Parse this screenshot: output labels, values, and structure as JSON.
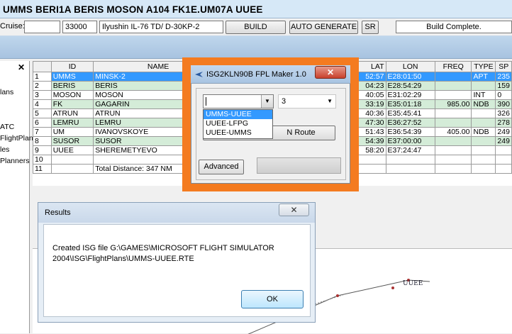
{
  "route_bar": {
    "text": "UMMS BERI1A BERIS MOSON A104 FK1E.UM07A UUEE"
  },
  "toolbar": {
    "cruise_label": "Cruise:",
    "cruise_value": "",
    "altitude": "33000",
    "aircraft": "Ilyushin IL-76 TD/ D-30KP-2",
    "build_label": "BUILD",
    "auto_generate_label": "AUTO GENERATE",
    "sr_label": "SR",
    "status": "Build Complete."
  },
  "left_pane": {
    "close": "✕",
    "items": [
      "lans",
      "ATC",
      "FlightPlans",
      "les",
      "Planners"
    ]
  },
  "grid": {
    "columns": [
      "",
      "ID",
      "NAME",
      "LAT",
      "LON",
      "FREQ",
      "TYPE",
      "SP"
    ],
    "rows": [
      {
        "n": "1",
        "id": "UMMS",
        "name": "MINSK-2",
        "lat": "52:57",
        "lon": "E28:01:50",
        "freq": "",
        "type": "APT",
        "sp": "235"
      },
      {
        "n": "2",
        "id": "BERIS",
        "name": "BERIS",
        "lat": "04:23",
        "lon": "E28:54:29",
        "freq": "",
        "type": "",
        "sp": "159"
      },
      {
        "n": "3",
        "id": "MOSON",
        "name": "MOSON",
        "lat": "40:05",
        "lon": "E31:02:29",
        "freq": "",
        "type": "INT",
        "sp": "0"
      },
      {
        "n": "4",
        "id": "FK",
        "name": "GAGARIN",
        "lat": "33:19",
        "lon": "E35:01:18",
        "freq": "985.00",
        "type": "NDB",
        "sp": "390"
      },
      {
        "n": "5",
        "id": "ATRUN",
        "name": "ATRUN",
        "lat": "40:36",
        "lon": "E35:45:41",
        "freq": "",
        "type": "",
        "sp": "326"
      },
      {
        "n": "6",
        "id": "LEMRU",
        "name": "LEMRU",
        "lat": "47:30",
        "lon": "E36:27:52",
        "freq": "",
        "type": "",
        "sp": "278"
      },
      {
        "n": "7",
        "id": "UM",
        "name": "IVANOVSKOYE",
        "lat": "51:43",
        "lon": "E36:54:39",
        "freq": "405.00",
        "type": "NDB",
        "sp": "249"
      },
      {
        "n": "8",
        "id": "SUSOR",
        "name": "SUSOR",
        "lat": "54:39",
        "lon": "E37:00:00",
        "freq": "",
        "type": "",
        "sp": "249"
      },
      {
        "n": "9",
        "id": "UUEE",
        "name": "SHEREMETYEVO",
        "lat": "58:20",
        "lon": "E37:24:47",
        "freq": "",
        "type": "",
        "sp": ""
      },
      {
        "n": "10",
        "id": "",
        "name": "",
        "lat": "",
        "lon": "",
        "freq": "",
        "type": "",
        "sp": ""
      },
      {
        "n": "11",
        "id": "",
        "name": "Total Distance: 347 NM",
        "lat": "",
        "lon": "",
        "freq": "",
        "type": "",
        "sp": ""
      }
    ]
  },
  "fpl_window": {
    "title": "ISG2KLN90B  FPL Maker 1.0",
    "close": "✕",
    "route_combo_value": "",
    "number_combo_value": "3",
    "route_button_label": "N Route",
    "advanced_label": "Advanced",
    "dropdown_options": [
      "UMMS-UUEE",
      "UUEE-LFPG",
      "UUEE-UMMS"
    ]
  },
  "results_dialog": {
    "title": "Results",
    "close": "✕",
    "message_line1": "Created ISG file  G:\\GAMES\\MICROSOFT FLIGHT SIMULATOR",
    "message_line2": "2004\\ISG\\FlightPlans\\UMMS-UUEE.RTE",
    "ok_label": "OK"
  },
  "map": {
    "label": "UUEE"
  },
  "colors": {
    "highlight_frame": "#f47b20",
    "selection": "#3399ff",
    "row_shade": "#d4ecd8"
  }
}
